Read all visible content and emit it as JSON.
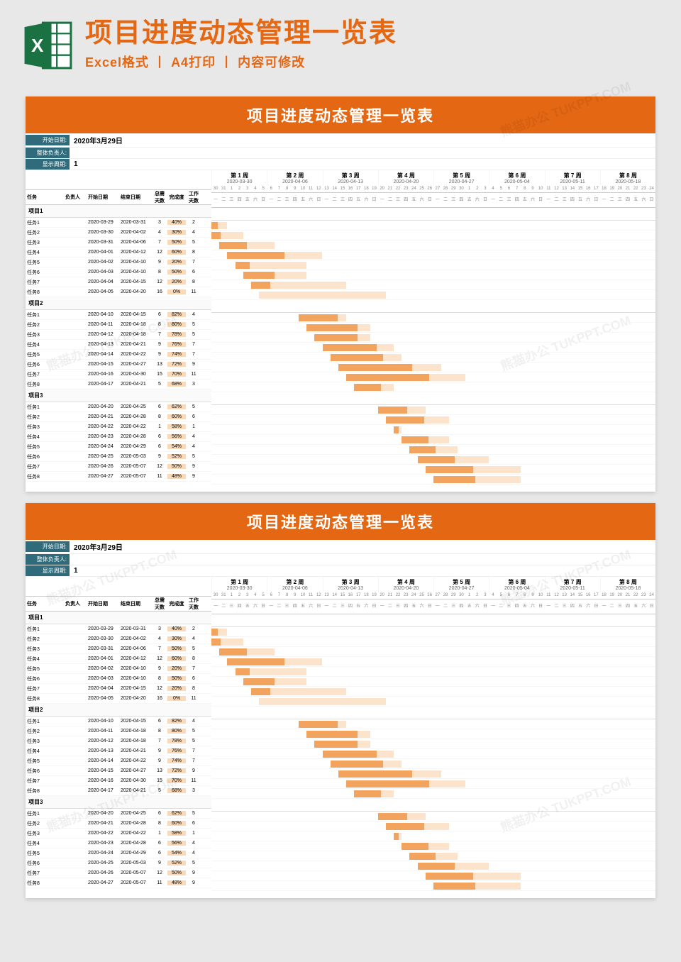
{
  "header": {
    "title": "项目进度动态管理一览表",
    "sub_a": "Excel格式",
    "sub_b": "A4打印",
    "sub_c": "内容可修改",
    "sep": " 丨 "
  },
  "sheet": {
    "title": "项目进度动态管理一览表",
    "meta": {
      "start_label": "开始日期:",
      "start_value": "2020年3月29日",
      "leader_label": "整体负责人:",
      "leader_value": "",
      "cycle_label": "显示周期:",
      "cycle_value": "1"
    },
    "columns": {
      "task": "任务",
      "owner": "负责人",
      "start": "开始日期",
      "end": "结束日期",
      "days": "总需天数",
      "progress": "完成度",
      "workdays": "工作天数"
    },
    "weeks": [
      {
        "label": "第 1 周",
        "date": "2020-03-30"
      },
      {
        "label": "第 2 周",
        "date": "2020-04-06"
      },
      {
        "label": "第 3 周",
        "date": "2020-04-13"
      },
      {
        "label": "第 4 周",
        "date": "2020-04-20"
      },
      {
        "label": "第 5 周",
        "date": "2020-04-27"
      },
      {
        "label": "第 6 周",
        "date": "2020-05-04"
      },
      {
        "label": "第 7 周",
        "date": "2020-05-11"
      },
      {
        "label": "第 8 周",
        "date": "2020-05-18"
      }
    ],
    "daynums": [
      "30",
      "31",
      "1",
      "2",
      "3",
      "4",
      "5",
      "6",
      "7",
      "8",
      "9",
      "10",
      "11",
      "12",
      "13",
      "14",
      "15",
      "16",
      "17",
      "18",
      "19",
      "20",
      "21",
      "22",
      "23",
      "24",
      "25",
      "26",
      "27",
      "28",
      "29",
      "30",
      "1",
      "2",
      "3",
      "4",
      "5",
      "6",
      "7",
      "8",
      "9",
      "10",
      "11",
      "12",
      "13",
      "14",
      "15",
      "16",
      "17",
      "18",
      "19",
      "20",
      "21",
      "22",
      "23",
      "24"
    ],
    "daynames": [
      "一",
      "二",
      "三",
      "四",
      "五",
      "六",
      "日",
      "一",
      "二",
      "三",
      "四",
      "五",
      "六",
      "日",
      "一",
      "二",
      "三",
      "四",
      "五",
      "六",
      "日",
      "一",
      "二",
      "三",
      "四",
      "五",
      "六",
      "日",
      "一",
      "二",
      "三",
      "四",
      "五",
      "六",
      "日",
      "一",
      "二",
      "三",
      "四",
      "五",
      "六",
      "日",
      "一",
      "二",
      "三",
      "四",
      "五",
      "六",
      "日",
      "一",
      "二",
      "三",
      "四",
      "五",
      "六",
      "日"
    ],
    "groups": [
      {
        "name": "项目1",
        "tasks": [
          {
            "name": "任务1",
            "start": "2020-03-29",
            "end": "2020-03-31",
            "days": 3,
            "progress": "40%",
            "work": 2,
            "offset": -1,
            "dur": 3,
            "pct": 0.4
          },
          {
            "name": "任务2",
            "start": "2020-03-30",
            "end": "2020-04-02",
            "days": 4,
            "progress": "30%",
            "work": 4,
            "offset": 0,
            "dur": 4,
            "pct": 0.3
          },
          {
            "name": "任务3",
            "start": "2020-03-31",
            "end": "2020-04-06",
            "days": 7,
            "progress": "50%",
            "work": 5,
            "offset": 1,
            "dur": 7,
            "pct": 0.5
          },
          {
            "name": "任务4",
            "start": "2020-04-01",
            "end": "2020-04-12",
            "days": 12,
            "progress": "60%",
            "work": 8,
            "offset": 2,
            "dur": 12,
            "pct": 0.6
          },
          {
            "name": "任务5",
            "start": "2020-04-02",
            "end": "2020-04-10",
            "days": 9,
            "progress": "20%",
            "work": 7,
            "offset": 3,
            "dur": 9,
            "pct": 0.2
          },
          {
            "name": "任务6",
            "start": "2020-04-03",
            "end": "2020-04-10",
            "days": 8,
            "progress": "50%",
            "work": 6,
            "offset": 4,
            "dur": 8,
            "pct": 0.5
          },
          {
            "name": "任务7",
            "start": "2020-04-04",
            "end": "2020-04-15",
            "days": 12,
            "progress": "20%",
            "work": 8,
            "offset": 5,
            "dur": 12,
            "pct": 0.2
          },
          {
            "name": "任务8",
            "start": "2020-04-05",
            "end": "2020-04-20",
            "days": 16,
            "progress": "0%",
            "work": 11,
            "offset": 6,
            "dur": 16,
            "pct": 0.0
          }
        ]
      },
      {
        "name": "项目2",
        "tasks": [
          {
            "name": "任务1",
            "start": "2020-04-10",
            "end": "2020-04-15",
            "days": 6,
            "progress": "82%",
            "work": 4,
            "offset": 11,
            "dur": 6,
            "pct": 0.82
          },
          {
            "name": "任务2",
            "start": "2020-04-11",
            "end": "2020-04-18",
            "days": 8,
            "progress": "80%",
            "work": 5,
            "offset": 12,
            "dur": 8,
            "pct": 0.8
          },
          {
            "name": "任务3",
            "start": "2020-04-12",
            "end": "2020-04-18",
            "days": 7,
            "progress": "78%",
            "work": 5,
            "offset": 13,
            "dur": 7,
            "pct": 0.78
          },
          {
            "name": "任务4",
            "start": "2020-04-13",
            "end": "2020-04-21",
            "days": 9,
            "progress": "76%",
            "work": 7,
            "offset": 14,
            "dur": 9,
            "pct": 0.76
          },
          {
            "name": "任务5",
            "start": "2020-04-14",
            "end": "2020-04-22",
            "days": 9,
            "progress": "74%",
            "work": 7,
            "offset": 15,
            "dur": 9,
            "pct": 0.74
          },
          {
            "name": "任务6",
            "start": "2020-04-15",
            "end": "2020-04-27",
            "days": 13,
            "progress": "72%",
            "work": 9,
            "offset": 16,
            "dur": 13,
            "pct": 0.72
          },
          {
            "name": "任务7",
            "start": "2020-04-16",
            "end": "2020-04-30",
            "days": 15,
            "progress": "70%",
            "work": 11,
            "offset": 17,
            "dur": 15,
            "pct": 0.7
          },
          {
            "name": "任务8",
            "start": "2020-04-17",
            "end": "2020-04-21",
            "days": 5,
            "progress": "68%",
            "work": 3,
            "offset": 18,
            "dur": 5,
            "pct": 0.68
          }
        ]
      },
      {
        "name": "项目3",
        "tasks": [
          {
            "name": "任务1",
            "start": "2020-04-20",
            "end": "2020-04-25",
            "days": 6,
            "progress": "62%",
            "work": 5,
            "offset": 21,
            "dur": 6,
            "pct": 0.62
          },
          {
            "name": "任务2",
            "start": "2020-04-21",
            "end": "2020-04-28",
            "days": 8,
            "progress": "60%",
            "work": 6,
            "offset": 22,
            "dur": 8,
            "pct": 0.6
          },
          {
            "name": "任务3",
            "start": "2020-04-22",
            "end": "2020-04-22",
            "days": 1,
            "progress": "58%",
            "work": 1,
            "offset": 23,
            "dur": 1,
            "pct": 0.58
          },
          {
            "name": "任务4",
            "start": "2020-04-23",
            "end": "2020-04-28",
            "days": 6,
            "progress": "56%",
            "work": 4,
            "offset": 24,
            "dur": 6,
            "pct": 0.56
          },
          {
            "name": "任务5",
            "start": "2020-04-24",
            "end": "2020-04-29",
            "days": 6,
            "progress": "54%",
            "work": 4,
            "offset": 25,
            "dur": 6,
            "pct": 0.54
          },
          {
            "name": "任务6",
            "start": "2020-04-25",
            "end": "2020-05-03",
            "days": 9,
            "progress": "52%",
            "work": 5,
            "offset": 26,
            "dur": 9,
            "pct": 0.52
          },
          {
            "name": "任务7",
            "start": "2020-04-26",
            "end": "2020-05-07",
            "days": 12,
            "progress": "50%",
            "work": 9,
            "offset": 27,
            "dur": 12,
            "pct": 0.5
          },
          {
            "name": "任务8",
            "start": "2020-04-27",
            "end": "2020-05-07",
            "days": 11,
            "progress": "48%",
            "work": 9,
            "offset": 28,
            "dur": 11,
            "pct": 0.48
          }
        ]
      }
    ]
  },
  "watermark": "熊猫办公 TUKPPT.COM"
}
